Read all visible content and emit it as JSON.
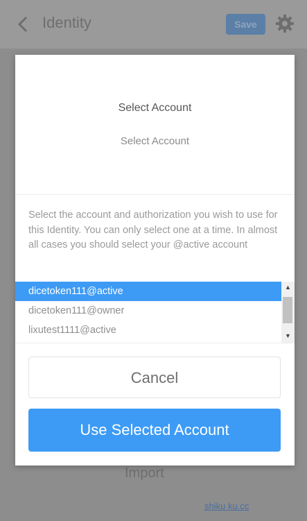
{
  "app": {
    "title": "Identity",
    "save_label": "Save",
    "import_label": "Import",
    "watermark": "shiku ku.cc"
  },
  "modal": {
    "title": "Select Account",
    "subtitle": "Select Account",
    "description": "Select the account and authorization you wish to use for this Identity. You can only select one at a time. In almost all cases you should select your @active account",
    "accounts": [
      {
        "label": "dicetoken111@active",
        "selected": true
      },
      {
        "label": "dicetoken111@owner",
        "selected": false
      },
      {
        "label": "lixutest1111@active",
        "selected": false
      }
    ],
    "cancel_label": "Cancel",
    "use_label": "Use Selected Account"
  },
  "colors": {
    "accent": "#3d9bf5",
    "overlay": "#8d8d8d",
    "save_button": "#5b7fa7"
  },
  "icons": [
    "back-icon",
    "gear-icon",
    "scroll-up-icon",
    "scroll-down-icon"
  ]
}
